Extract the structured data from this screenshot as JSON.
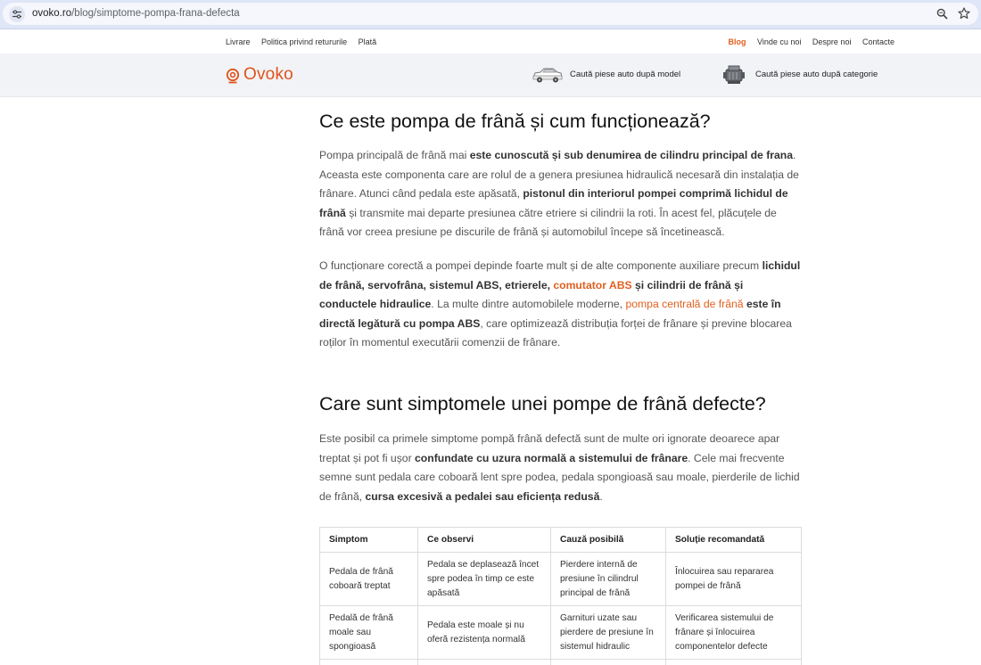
{
  "browser": {
    "url_host": "ovoko.ro",
    "url_path": "/blog/simptome-pompa-frana-defecta"
  },
  "topbar": {
    "left_links": [
      "Livrare",
      "Politica privind retururile",
      "Plată"
    ],
    "right_links": [
      "Blog",
      "Vinde cu noi",
      "Despre noi",
      "Contacte"
    ],
    "active_link": "Blog"
  },
  "header": {
    "logo_text": "Ovoko",
    "nav_model": "Caută piese auto după model",
    "nav_category": "Caută piese auto după categorie"
  },
  "colors": {
    "brand": "#e0531c",
    "link": "#e06020"
  },
  "article": {
    "h1": "Ce este pompa de frână și cum funcționează?",
    "p1": {
      "t1": "Pompa principală de frână mai ",
      "b1": "este cunoscută și sub denumirea de cilindru principal de frana",
      "t2": ". Aceasta este componenta care are rolul de a genera presiunea hidraulică necesară din instalația de frânare. Atunci când pedala este apăsată, ",
      "b2": "pistonul din interiorul pompei  comprimă lichidul de frână",
      "t3": " și transmite mai departe presiunea către etriere si cilindrii la roti. În acest fel, plăcuțele de frână vor creea presiune pe discurile de frână și automobilul începe să încetinească."
    },
    "p2": {
      "t1": "O funcționare corectă a pompei depinde foarte mult și de alte componente auxiliare precum ",
      "b1": "lichidul de frână, servofrâna, sistemul ABS, etrierele, ",
      "link1": "comutator ABS",
      "b2": " și cilindrii de frână și conductele hidraulice",
      "t2": ". La multe dintre automobilele moderne, ",
      "link2": "pompa centrală de frână",
      "b3": " este în directă legătură cu pompa ABS",
      "t3": ", care optimizează distribuția forței de frânare și previne blocarea roților în momentul executării comenzii de frânare."
    },
    "h2": "Care sunt simptomele unei pompe de frână defecte?",
    "p3": {
      "t1": "Este posibil ca primele simptome pompă frână defectă sunt de multe ori ignorate deoarece apar treptat și pot fi ușor ",
      "b1": "confundate cu uzura normală a sistemului de frânare",
      "t2": ". Cele mai frecvente semne sunt pedala care coboară lent spre podea, pedala spongioasă sau moale, pierderile de lichid de frână, ",
      "b2": "cursa excesivă a pedalei sau eficiența redusă",
      "t3": "."
    },
    "table": {
      "headers": [
        "Simptom",
        "Ce observi",
        "Cauză posibilă",
        "Soluție recomandată"
      ],
      "rows": [
        [
          "Pedala de frână coboară treptat",
          "Pedala se deplasează încet spre podea în timp ce este apăsată",
          "Pierdere internă de presiune în cilindrul principal de frână",
          "Înlocuirea sau repararea pompei de frână"
        ],
        [
          "Pedală de frână moale sau spongioasă",
          "Pedala este moale și nu oferă rezistența normală",
          "Garnituri uzate sau pierdere de presiune în sistemul hidraulic",
          "Verificarea sistemului de frânare și înlocuirea componentelor defecte"
        ]
      ]
    }
  }
}
